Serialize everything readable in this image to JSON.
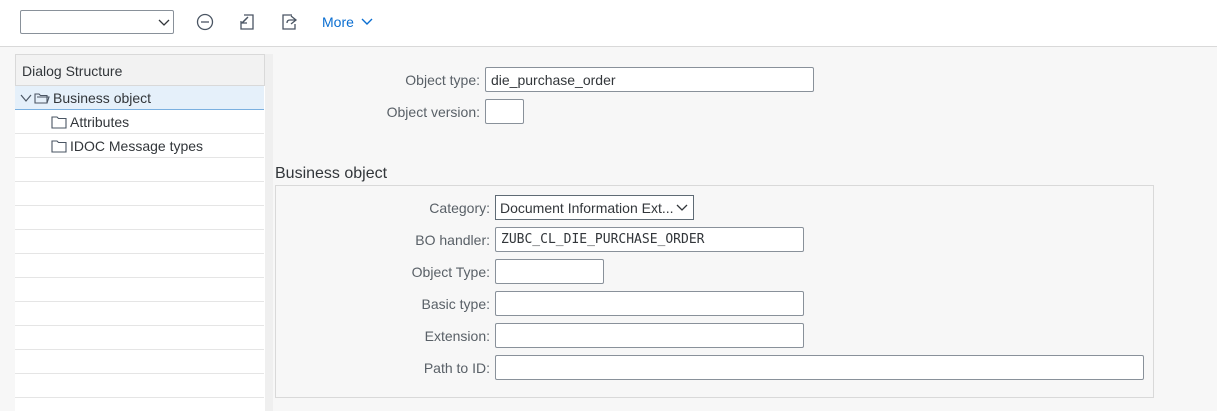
{
  "toolbar": {
    "select_value": "",
    "icons": [
      "minus-circle-icon",
      "back-document-icon",
      "forward-document-icon"
    ],
    "more_label": "More"
  },
  "dialog_structure": {
    "title": "Dialog Structure",
    "items": [
      {
        "label": "Business object",
        "expanded": true,
        "selected": true
      },
      {
        "label": "Attributes"
      },
      {
        "label": "IDOC Message types"
      }
    ]
  },
  "header_fields": {
    "object_type_label": "Object type:",
    "object_type_value": "die_purchase_order",
    "object_version_label": "Object version:",
    "object_version_value": ""
  },
  "business_object": {
    "title": "Business object",
    "category_label": "Category:",
    "category_value": "Document Information Ext...",
    "bo_handler_label": "BO handler:",
    "bo_handler_value": "ZUBC_CL_DIE_PURCHASE_ORDER",
    "object_type_label": "Object Type:",
    "object_type_value": "",
    "basic_type_label": "Basic type:",
    "basic_type_value": "",
    "extension_label": "Extension:",
    "extension_value": "",
    "path_to_id_label": "Path to ID:",
    "path_to_id_value": ""
  },
  "colors": {
    "accent": "#0a6ed1",
    "selected_row": "#e5f0fa",
    "background": "#f7f7f7"
  }
}
